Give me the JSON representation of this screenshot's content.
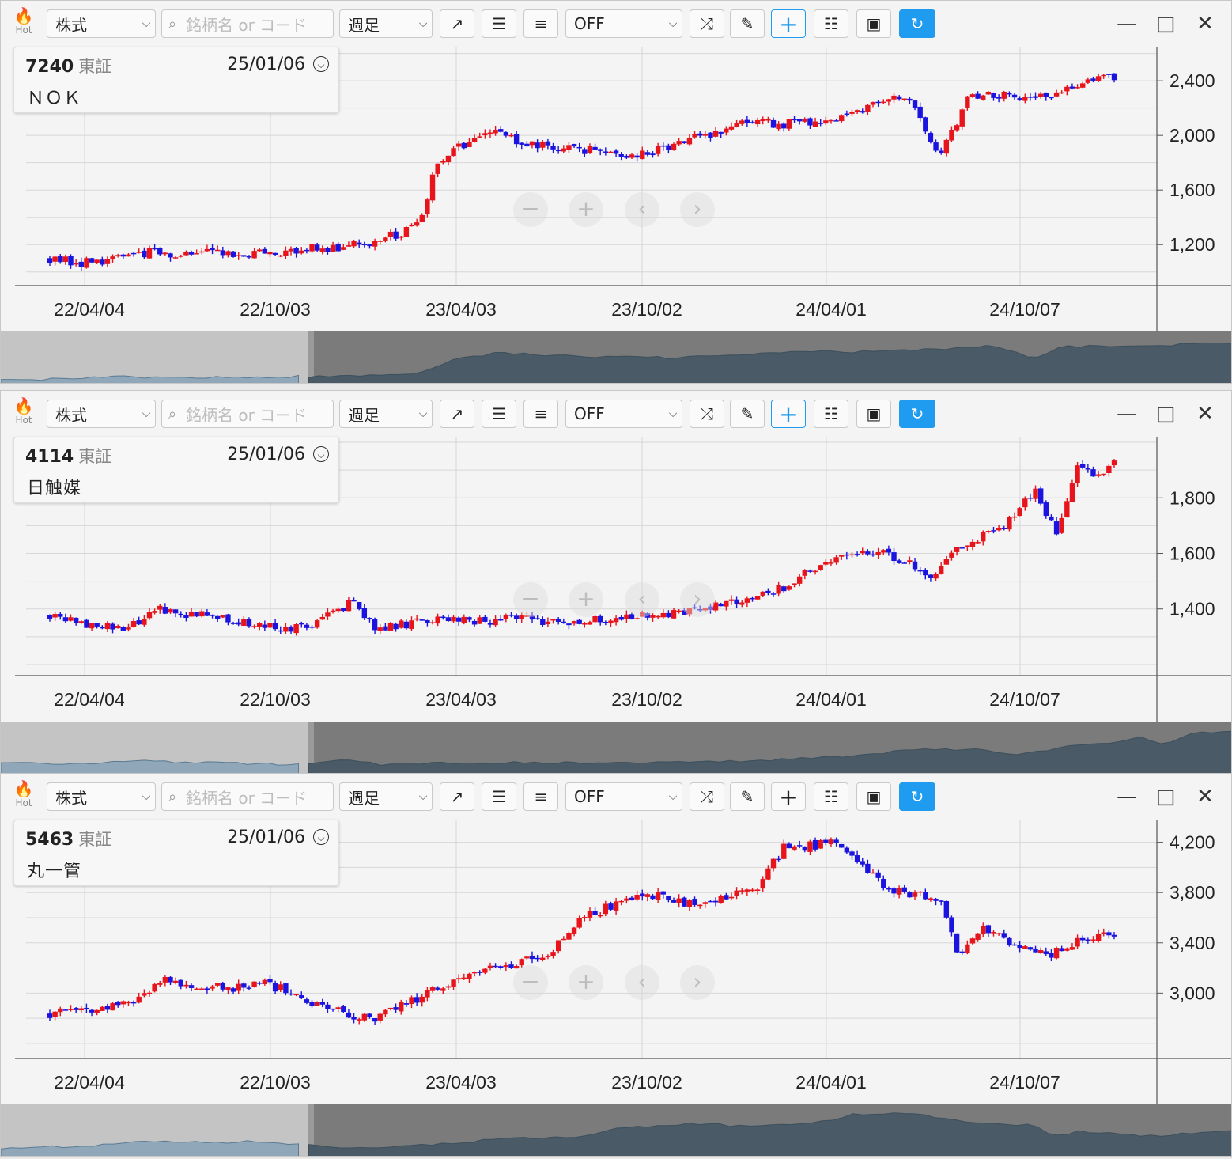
{
  "panels": [
    {
      "hot_label": "Hot",
      "asset_type": "株式",
      "search_placeholder": "銘柄名 or コード",
      "period": "週足",
      "indicator": "OFF",
      "code": "7240",
      "exchange": "東証",
      "date": "25/01/06",
      "name": "ＮＯＫ",
      "crosshair_active": true,
      "y_ticks": [
        "2,400",
        "2,000",
        "1,600",
        "1,200"
      ],
      "x_ticks": [
        "22/04/04",
        "22/10/03",
        "23/04/03",
        "23/10/02",
        "24/04/01",
        "24/10/07"
      ]
    },
    {
      "hot_label": "Hot",
      "asset_type": "株式",
      "search_placeholder": "銘柄名 or コード",
      "period": "週足",
      "indicator": "OFF",
      "code": "4114",
      "exchange": "東証",
      "date": "25/01/06",
      "name": "日触媒",
      "crosshair_active": true,
      "y_ticks": [
        "1,800",
        "1,600",
        "1,400"
      ],
      "x_ticks": [
        "22/04/04",
        "22/10/03",
        "23/04/03",
        "23/10/02",
        "24/04/01",
        "24/10/07"
      ]
    },
    {
      "hot_label": "Hot",
      "asset_type": "株式",
      "search_placeholder": "銘柄名 or コード",
      "period": "週足",
      "indicator": "OFF",
      "code": "5463",
      "exchange": "東証",
      "date": "25/01/06",
      "name": "丸一管",
      "crosshair_active": false,
      "y_ticks": [
        "4,200",
        "3,800",
        "3,400",
        "3,000"
      ],
      "x_ticks": [
        "22/04/04",
        "22/10/03",
        "23/04/03",
        "23/10/02",
        "24/04/01",
        "24/10/07"
      ]
    }
  ],
  "colors": {
    "up": "#e8141b",
    "down": "#1b14e0",
    "accent": "#1f9bf0"
  },
  "icons": [
    "hot-flame-icon",
    "search-icon",
    "trendline-icon",
    "align-left-icon",
    "align-right-icon",
    "shuffle-icon",
    "pencil-icon",
    "crosshair-icon",
    "settings-sliders-icon",
    "camera-icon",
    "refresh-icon",
    "minimize-icon",
    "maximize-icon",
    "close-icon",
    "zoom-out-icon",
    "zoom-in-icon",
    "scroll-left-icon",
    "scroll-right-icon"
  ],
  "chart_data": [
    {
      "type": "candlestick",
      "title": "7240 ＮＯＫ 週足",
      "x_labels": [
        "22/04/04",
        "22/10/03",
        "23/04/03",
        "23/10/02",
        "24/04/01",
        "24/10/07"
      ],
      "ylim": [
        900,
        2650
      ],
      "key_closes": [
        [
          0,
          1100
        ],
        [
          6,
          1060
        ],
        [
          20,
          1150
        ],
        [
          26,
          1130
        ],
        [
          40,
          1140
        ],
        [
          60,
          1200
        ],
        [
          70,
          1330
        ],
        [
          74,
          1800
        ],
        [
          83,
          2050
        ],
        [
          90,
          1950
        ],
        [
          100,
          1900
        ],
        [
          112,
          1850
        ],
        [
          120,
          1950
        ],
        [
          134,
          2100
        ],
        [
          140,
          2080
        ],
        [
          150,
          2120
        ],
        [
          163,
          2300
        ],
        [
          170,
          1850
        ],
        [
          175,
          2270
        ],
        [
          182,
          2300
        ],
        [
          190,
          2280
        ],
        [
          200,
          2450
        ],
        [
          203,
          2430
        ]
      ]
    },
    {
      "type": "candlestick",
      "title": "4114 日触媒 週足",
      "x_labels": [
        "22/04/04",
        "22/10/03",
        "23/04/03",
        "23/10/02",
        "24/04/01",
        "24/10/07"
      ],
      "ylim": [
        1160,
        2020
      ],
      "key_closes": [
        [
          0,
          1380
        ],
        [
          6,
          1340
        ],
        [
          15,
          1330
        ],
        [
          20,
          1400
        ],
        [
          35,
          1360
        ],
        [
          48,
          1330
        ],
        [
          58,
          1430
        ],
        [
          62,
          1330
        ],
        [
          75,
          1360
        ],
        [
          90,
          1360
        ],
        [
          100,
          1350
        ],
        [
          118,
          1380
        ],
        [
          130,
          1420
        ],
        [
          140,
          1480
        ],
        [
          150,
          1590
        ],
        [
          160,
          1600
        ],
        [
          168,
          1520
        ],
        [
          175,
          1640
        ],
        [
          182,
          1700
        ],
        [
          188,
          1820
        ],
        [
          192,
          1680
        ],
        [
          196,
          1900
        ],
        [
          200,
          1890
        ],
        [
          203,
          1930
        ]
      ]
    },
    {
      "type": "candlestick",
      "title": "5463 丸一管 週足",
      "x_labels": [
        "22/04/04",
        "22/10/03",
        "23/04/03",
        "23/10/02",
        "24/04/01",
        "24/10/07"
      ],
      "ylim": [
        2480,
        4380
      ],
      "key_closes": [
        [
          0,
          2830
        ],
        [
          14,
          2900
        ],
        [
          22,
          3100
        ],
        [
          35,
          3030
        ],
        [
          40,
          3100
        ],
        [
          55,
          2850
        ],
        [
          62,
          2800
        ],
        [
          72,
          3000
        ],
        [
          84,
          3200
        ],
        [
          95,
          3300
        ],
        [
          102,
          3600
        ],
        [
          113,
          3800
        ],
        [
          123,
          3700
        ],
        [
          135,
          3850
        ],
        [
          140,
          4150
        ],
        [
          150,
          4200
        ],
        [
          160,
          3820
        ],
        [
          170,
          3750
        ],
        [
          173,
          3300
        ],
        [
          178,
          3500
        ],
        [
          190,
          3300
        ],
        [
          200,
          3480
        ],
        [
          203,
          3480
        ]
      ]
    }
  ]
}
